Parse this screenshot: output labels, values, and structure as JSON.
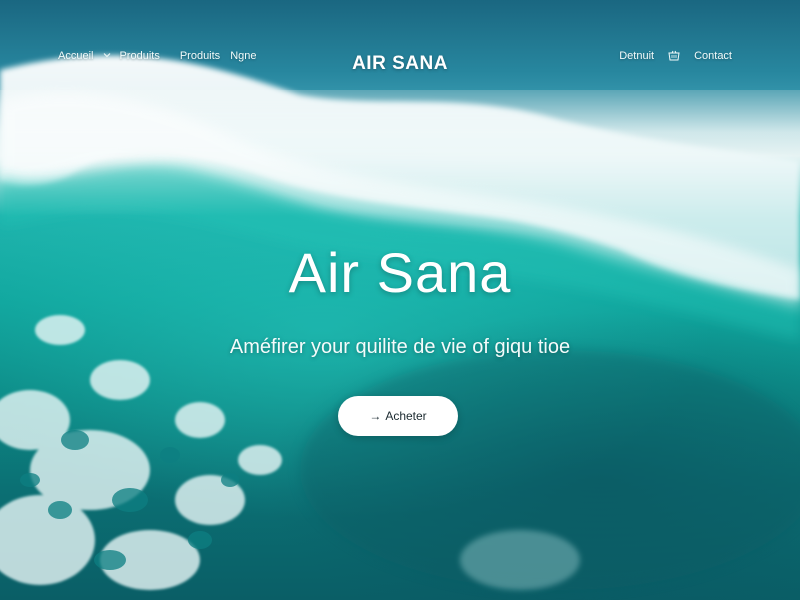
{
  "nav": {
    "left": {
      "home": "Accueil",
      "products_1": "Produits",
      "products_2": "Produits",
      "signup": "Ngne"
    },
    "brand": "AIR SANA",
    "right": {
      "account": "Detnuit",
      "contact": "Contact"
    }
  },
  "hero": {
    "title": "Air Sana",
    "subtitle": "Améfirer your quilite de vie of giqu tioe",
    "cta_arrow": "→",
    "cta_label": "Acheter"
  },
  "icons": {
    "nav_dropdown": "chevron-down-icon",
    "cart": "basket-icon",
    "cta_arrow": "arrow-right-icon"
  },
  "colors": {
    "ocean_deep": "#0a5e66",
    "ocean_turquoise": "#10a59d",
    "foam": "#e6f3f3",
    "button_bg": "#ffffff",
    "button_text": "#1b2a30"
  }
}
